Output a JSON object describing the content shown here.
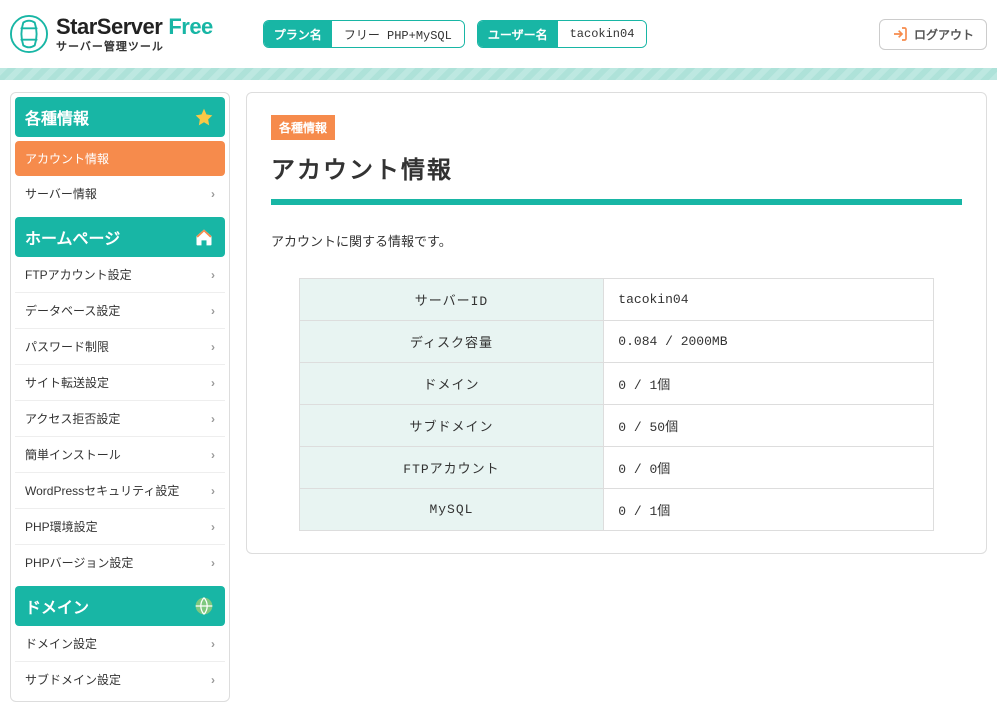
{
  "brand": {
    "name1": "StarServer",
    "name2": "Free",
    "sub": "サーバー管理ツール"
  },
  "header": {
    "plan_label": "プラン名",
    "plan_value": "フリー PHP+MySQL",
    "user_label": "ユーザー名",
    "user_value": "tacokin04",
    "logout": "ログアウト"
  },
  "sidebar": {
    "sec1": {
      "title": "各種情報",
      "items": [
        "アカウント情報",
        "サーバー情報"
      ]
    },
    "sec2": {
      "title": "ホームページ",
      "items": [
        "FTPアカウント設定",
        "データベース設定",
        "パスワード制限",
        "サイト転送設定",
        "アクセス拒否設定",
        "簡単インストール",
        "WordPressセキュリティ設定",
        "PHP環境設定",
        "PHPバージョン設定"
      ]
    },
    "sec3": {
      "title": "ドメイン",
      "items": [
        "ドメイン設定",
        "サブドメイン設定"
      ]
    }
  },
  "main": {
    "badge": "各種情報",
    "title": "アカウント情報",
    "desc": "アカウントに関する情報です。",
    "rows": [
      {
        "k": "サーバーID",
        "v": "tacokin04"
      },
      {
        "k": "ディスク容量",
        "v": "0.084 / 2000MB"
      },
      {
        "k": "ドメイン",
        "v": "0 / 1個"
      },
      {
        "k": "サブドメイン",
        "v": "0 / 50個"
      },
      {
        "k": "FTPアカウント",
        "v": "0 / 0個"
      },
      {
        "k": "MySQL",
        "v": "0 / 1個"
      }
    ]
  }
}
